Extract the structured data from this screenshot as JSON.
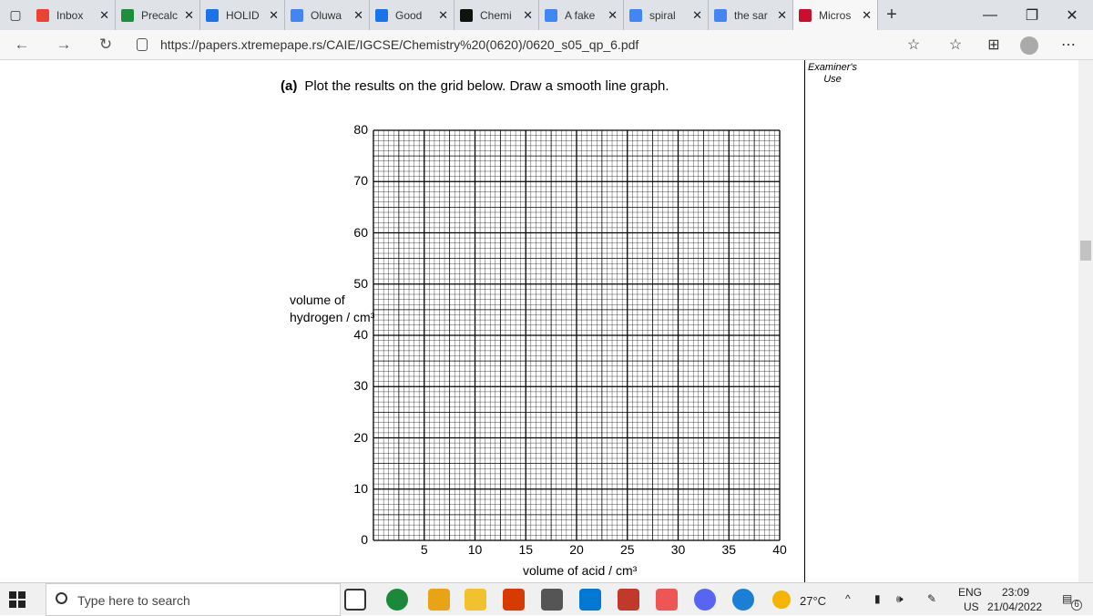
{
  "tabs": [
    {
      "label": "Inbox",
      "icon": "gmail-icon",
      "color": "#ea4335"
    },
    {
      "label": "Precalc",
      "icon": "classroom-icon",
      "color": "#1e8e3e"
    },
    {
      "label": "HOLID",
      "icon": "classroom-icon",
      "color": "#1a73e8"
    },
    {
      "label": "Oluwa",
      "icon": "docs-icon",
      "color": "#4285f4"
    },
    {
      "label": "Good",
      "icon": "classroom-icon",
      "color": "#1a73e8"
    },
    {
      "label": "Chemi",
      "icon": "bing-icon",
      "color": "#111111"
    },
    {
      "label": "A fake",
      "icon": "google-icon",
      "color": "#4285f4"
    },
    {
      "label": "spiral",
      "icon": "google-icon",
      "color": "#4285f4"
    },
    {
      "label": "the sar",
      "icon": "google-icon",
      "color": "#4285f4"
    },
    {
      "label": "Micros",
      "icon": "xtreme-icon",
      "color": "#c8102e"
    }
  ],
  "address": {
    "url": "https://papers.xtremepape.rs/CAIE/IGCSE/Chemistry%20(0620)/0620_s05_qp_6.pdf"
  },
  "page": {
    "examiner": "Examiner's",
    "use": "Use",
    "question_label": "(a)",
    "question_text": "Plot the results on the grid below. Draw a smooth line graph.",
    "ylabel_line1": "volume of",
    "ylabel_line2": "hydrogen / cm³",
    "xlabel": "volume of acid / cm³",
    "yticks": [
      "80",
      "70",
      "60",
      "50",
      "40",
      "30",
      "20",
      "10",
      "0"
    ],
    "xticks": [
      "5",
      "10",
      "15",
      "20",
      "25",
      "30",
      "35",
      "40"
    ]
  },
  "taskbar": {
    "search_placeholder": "Type here to search",
    "weather": "27°C",
    "lang_top": "ENG",
    "lang_bottom": "US",
    "time": "23:09",
    "date": "21/04/2022",
    "notification_count": "6"
  }
}
